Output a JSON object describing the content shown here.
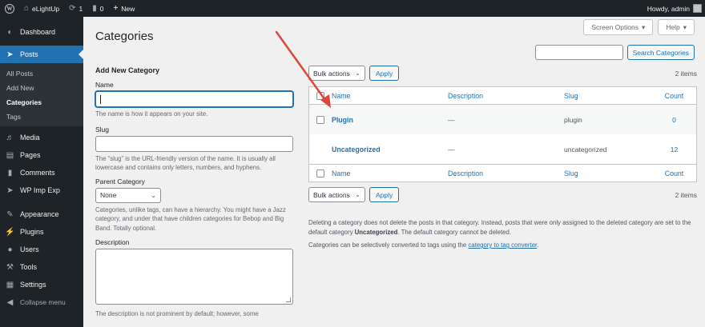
{
  "adminbar": {
    "site_name": "eLightUp",
    "updates_count": "1",
    "comments_count": "0",
    "new_label": "New",
    "howdy": "Howdy, admin"
  },
  "sidebar": {
    "items": [
      {
        "label": "Dashboard",
        "icon": "dashboard-icon"
      },
      {
        "label": "Posts",
        "icon": "pin-icon"
      },
      {
        "label": "Media",
        "icon": "media-icon"
      },
      {
        "label": "Pages",
        "icon": "pages-icon"
      },
      {
        "label": "Comments",
        "icon": "comments-icon"
      },
      {
        "label": "WP Imp Exp",
        "icon": "pin-icon"
      },
      {
        "label": "Appearance",
        "icon": "brush-icon"
      },
      {
        "label": "Plugins",
        "icon": "plugin-icon"
      },
      {
        "label": "Users",
        "icon": "users-icon"
      },
      {
        "label": "Tools",
        "icon": "wrench-icon"
      },
      {
        "label": "Settings",
        "icon": "settings-icon"
      },
      {
        "label": "Collapse menu",
        "icon": "collapse-icon"
      }
    ],
    "submenu": [
      "All Posts",
      "Add New",
      "Categories",
      "Tags"
    ]
  },
  "header": {
    "screen_options": "Screen Options",
    "help": "Help",
    "title": "Categories",
    "search_button": "Search Categories"
  },
  "form": {
    "heading": "Add New Category",
    "name_label": "Name",
    "name_help": "The name is how it appears on your site.",
    "slug_label": "Slug",
    "slug_help": "The “slug” is the URL-friendly version of the name. It is usually all lowercase and contains only letters, numbers, and hyphens.",
    "parent_label": "Parent Category",
    "parent_value": "None",
    "parent_help": "Categories, unlike tags, can have a hierarchy. You might have a Jazz category, and under that have children categories for Bebop and Big Band. Totally optional.",
    "description_label": "Description",
    "description_help": "The description is not prominent by default; however, some"
  },
  "table": {
    "bulk_actions": "Bulk actions",
    "apply": "Apply",
    "items_count": "2 items",
    "columns": {
      "name": "Name",
      "description": "Description",
      "slug": "Slug",
      "count": "Count"
    },
    "rows": [
      {
        "name": "Plugin",
        "description": "—",
        "slug": "plugin",
        "count": "0"
      },
      {
        "name": "Uncategorized",
        "description": "—",
        "slug": "uncategorized",
        "count": "12"
      }
    ]
  },
  "notes": {
    "line1_a": "Deleting a category does not delete the posts in that category. Instead, posts that were only assigned to the deleted category are set to the default category ",
    "line1_b": "Uncategorized",
    "line1_c": ". The default category cannot be deleted.",
    "line2_a": "Categories can be selectively converted to tags using the ",
    "line2_link": "category to tag converter",
    "line2_b": "."
  },
  "colors": {
    "accent": "#2271b1",
    "admin_bg": "#1d2327",
    "arrow": "#e0453a"
  }
}
